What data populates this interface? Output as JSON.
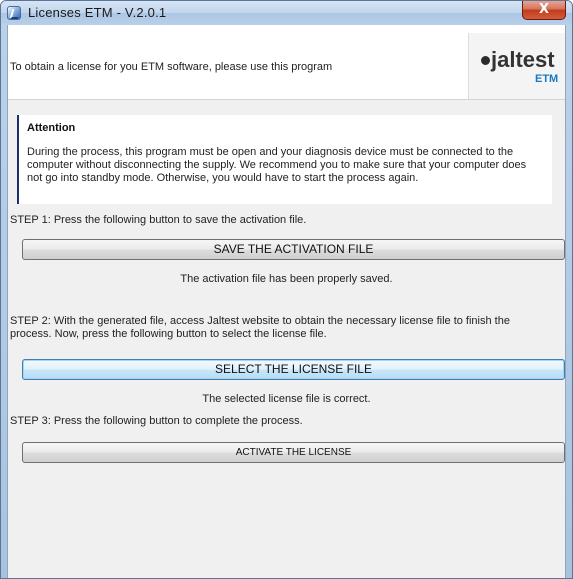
{
  "window": {
    "title": "Licenses ETM  -  V.2.0.1",
    "close_glyph": "X",
    "app_icon": "app-icon"
  },
  "header": {
    "text": "To obtain a license for you ETM software, please use this program",
    "logo_text": "jaltest",
    "logo_sub": "ETM"
  },
  "attention": {
    "title": "Attention",
    "body": "During the process, this program must be open and your diagnosis device must be connected to the computer without disconnecting the supply. We recommend you to make sure that your computer does not go into standby mode. Otherwise, you would have to start the process again."
  },
  "step1": {
    "text": "STEP 1: Press the following button to save the activation file.",
    "button_label": "SAVE THE ACTIVATION FILE",
    "status": "The activation file has been properly saved."
  },
  "step2": {
    "text": "STEP 2: With the generated file, access Jaltest website to obtain the necessary license file to finish the process. Now, press the following button to select the license file.",
    "button_label": "SELECT THE LICENSE FILE",
    "status": "The selected license file is correct."
  },
  "step3": {
    "text": "STEP 3: Press the following button to complete the process.",
    "button_label": "ACTIVATE THE LICENSE"
  },
  "colors": {
    "accent_blue": "#1a78c2",
    "attention_bar": "#1b2f6e",
    "focus_border": "#3c7fb1"
  }
}
